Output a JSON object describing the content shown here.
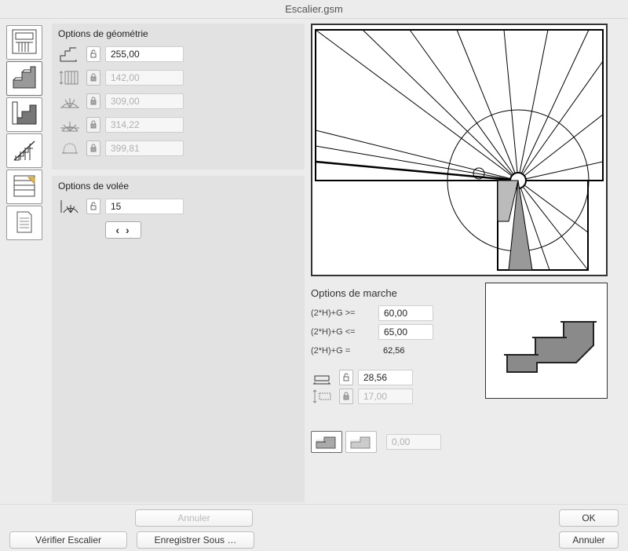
{
  "window": {
    "title": "Escalier.gsm"
  },
  "sidebar": {
    "items": [
      {
        "name": "stair-plan-icon"
      },
      {
        "name": "stair-step-icon"
      },
      {
        "name": "stair-section-icon"
      },
      {
        "name": "railing-icon"
      },
      {
        "name": "stair-list-icon"
      },
      {
        "name": "document-icon"
      }
    ],
    "active_index": 1
  },
  "geometry": {
    "title": "Options de géométrie",
    "rows": [
      {
        "icon": "stair-total-run-icon",
        "locked": false,
        "value": "255,00"
      },
      {
        "icon": "stair-height-icon",
        "locked": true,
        "value": "142,00"
      },
      {
        "icon": "stair-arc1-icon",
        "locked": true,
        "value": "309,00"
      },
      {
        "icon": "stair-arc2-icon",
        "locked": true,
        "value": "314,22"
      },
      {
        "icon": "stair-well-icon",
        "locked": true,
        "value": "399,81"
      }
    ]
  },
  "flight": {
    "title": "Options de volée",
    "icon": "flight-arc-icon",
    "locked": false,
    "value": "15",
    "stepper_label": "‹ ›"
  },
  "march": {
    "title": "Options de marche",
    "r1_label": "(2*H)+G >=",
    "r1_value": "60,00",
    "r2_label": "(2*H)+G <=",
    "r2_value": "65,00",
    "r3_label": "(2*H)+G =",
    "r3_value": "62,56",
    "going_icon": "tread-depth-icon",
    "going_locked": false,
    "going_value": "28,56",
    "rise_icon": "riser-height-icon",
    "rise_locked": true,
    "rise_value": "17,00",
    "toggle_sel": 0,
    "extra_value": "0,00"
  },
  "footer": {
    "cancel_upper": "Annuler",
    "ok": "OK",
    "verify": "Vérifier Escalier",
    "save_as": "Enregistrer Sous …",
    "cancel_lower": "Annuler"
  }
}
